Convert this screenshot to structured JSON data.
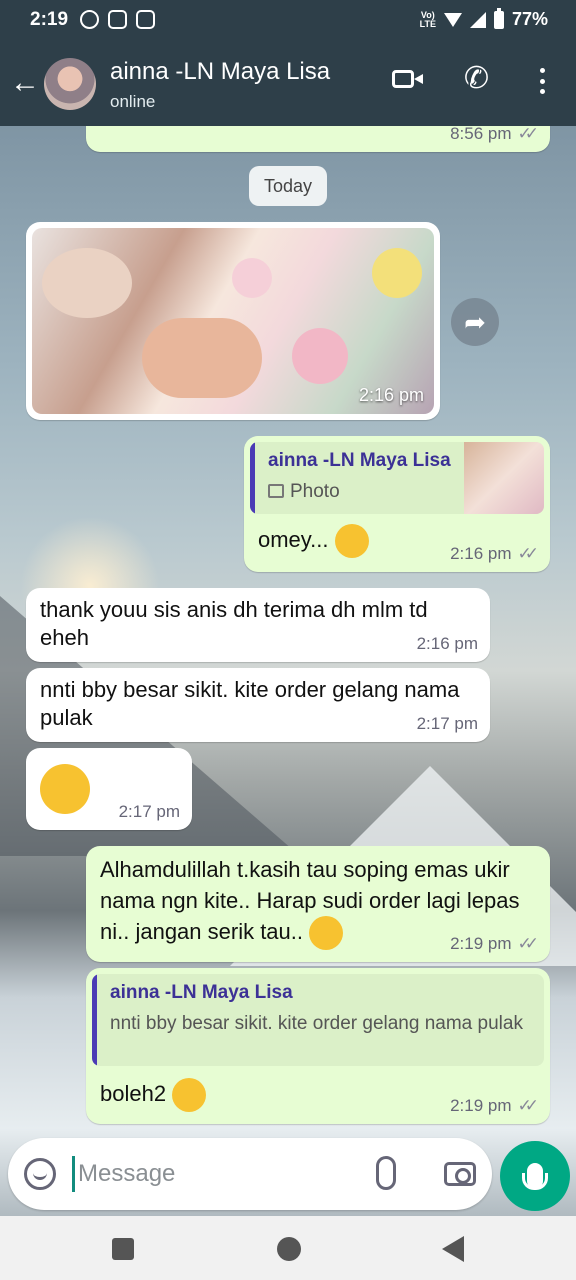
{
  "status_bar": {
    "time": "2:19",
    "battery": "77%",
    "network": "Vo) LTE"
  },
  "header": {
    "contact_name": "ainna -LN Maya Lisa",
    "status": "online"
  },
  "chat": {
    "prev_time": "8:56 pm",
    "day_label": "Today",
    "photo_msg": {
      "time": "2:16 pm"
    },
    "reply1": {
      "quote_name": "ainna -LN Maya Lisa",
      "quote_text": "Photo",
      "text": "omey...",
      "time": "2:16 pm"
    },
    "in1": {
      "text": "thank youu sis anis dh terima dh mlm td eheh",
      "time": "2:16 pm"
    },
    "in2": {
      "text": "nnti bby besar sikit. kite order gelang nama pulak",
      "time": "2:17 pm"
    },
    "in3": {
      "time": "2:17 pm"
    },
    "out2": {
      "text": "Alhamdulillah t.kasih tau soping emas ukir nama ngn kite.. Harap sudi order lagi lepas ni.. jangan serik tau..",
      "time": "2:19 pm"
    },
    "reply2": {
      "quote_name": "ainna -LN Maya Lisa",
      "quote_text": "nnti bby besar sikit. kite order gelang nama pulak",
      "text": "boleh2",
      "time": "2:19 pm"
    }
  },
  "input": {
    "placeholder": "Message"
  },
  "colors": {
    "header": "#2e3f49",
    "outgoing": "#e7fdd3",
    "accent": "#00a884"
  }
}
